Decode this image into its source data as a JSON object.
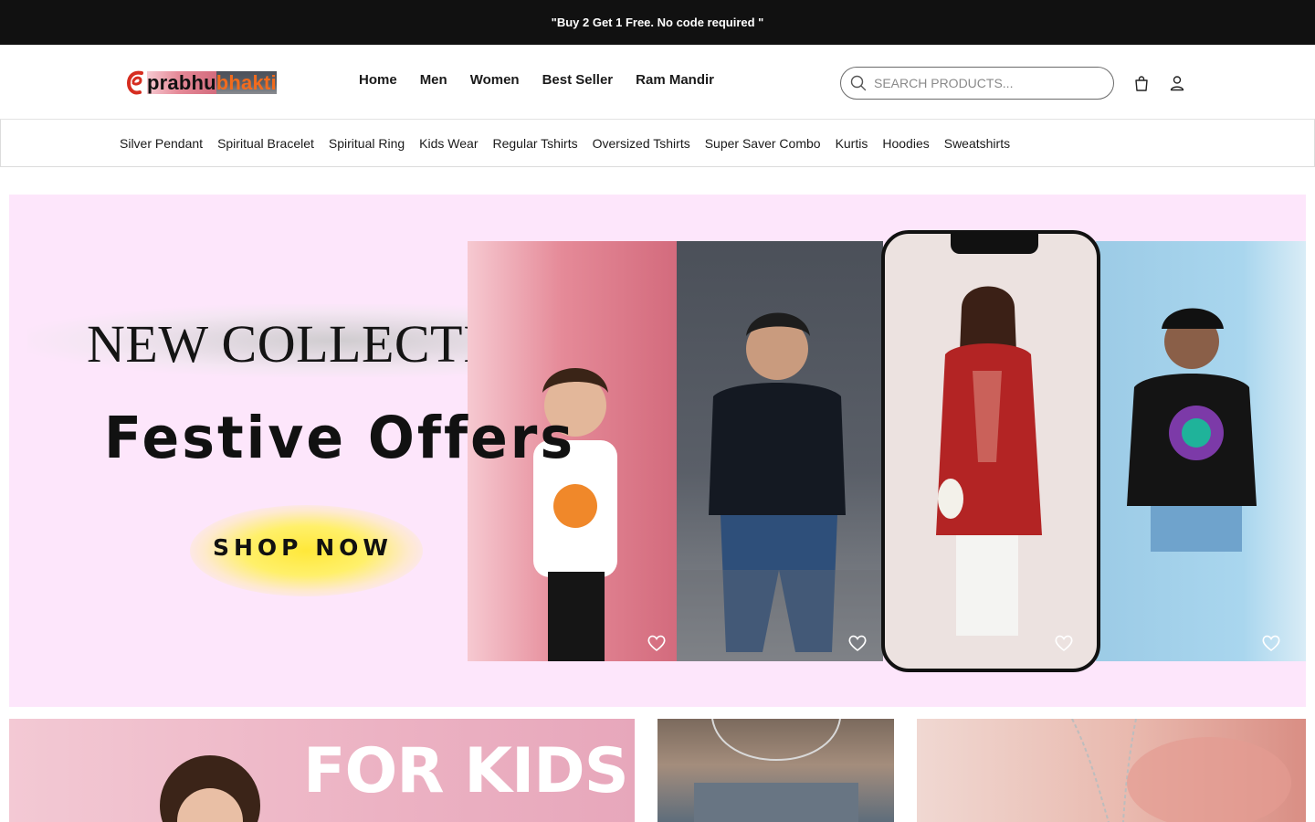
{
  "announcement": {
    "text": "\"Buy 2 Get 1 Free. No code required \""
  },
  "logo": {
    "part1": "prabhu",
    "part2": "bhakti"
  },
  "main_nav": [
    {
      "label": "Home"
    },
    {
      "label": "Men"
    },
    {
      "label": "Women"
    },
    {
      "label": "Best Seller"
    },
    {
      "label": "Ram Mandir"
    }
  ],
  "search": {
    "placeholder": "SEARCH PRODUCTS..."
  },
  "header_icons": [
    "bag-icon",
    "user-icon"
  ],
  "category_nav": [
    {
      "label": "Silver Pendant"
    },
    {
      "label": "Spiritual Bracelet"
    },
    {
      "label": "Spiritual Ring"
    },
    {
      "label": "Kids Wear"
    },
    {
      "label": "Regular Tshirts"
    },
    {
      "label": "Oversized Tshirts"
    },
    {
      "label": "Super Saver Combo"
    },
    {
      "label": "Kurtis"
    },
    {
      "label": "Hoodies"
    },
    {
      "label": "Sweatshirts"
    }
  ],
  "hero": {
    "title": "NEW COLLECTION",
    "subtitle": "Festive Offers",
    "cta": "SHOP NOW",
    "background": "#fde6fb"
  },
  "tiles": {
    "kids_text": "FOR KIDS"
  },
  "colors": {
    "announce_bg": "#111111",
    "brand_orange": "#f26b1d",
    "hero_bg": "#fde6fb"
  }
}
